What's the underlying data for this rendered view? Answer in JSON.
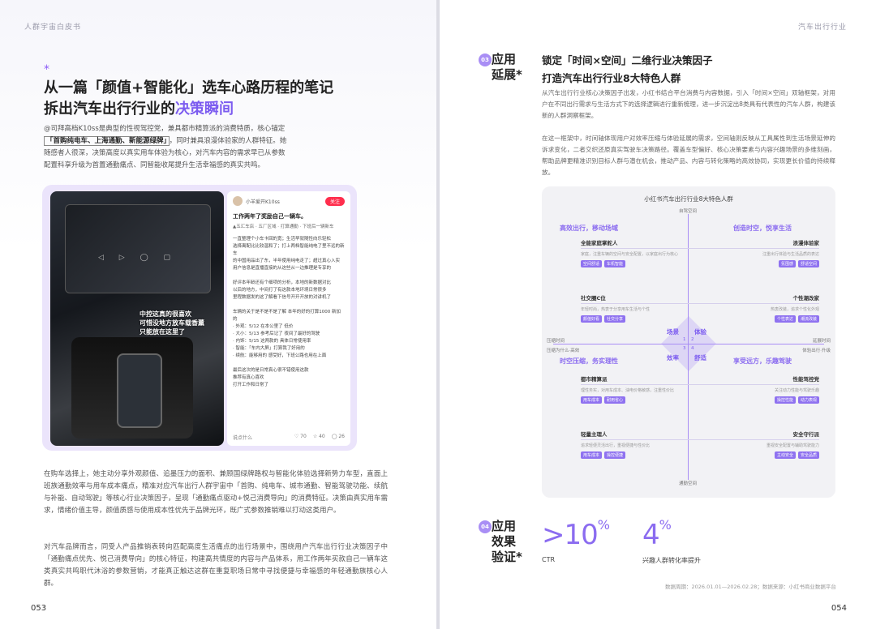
{
  "left": {
    "running_head": "人群宇宙白皮书",
    "star": "*",
    "title_line1": "从一篇「颜值+智能化」选车心路历程的笔记",
    "title_line2_a": "拆出汽车出行行业的",
    "title_line2_b": "决策瞬间",
    "intro_a": "@司拜高档K10ss是典型的性视驾控党，兼具都市精算派的消费特质，核心锚定",
    "intro_box": "「首购纯电车、上海通勤、新能源绿牌」",
    "intro_b": "，同时兼具浪漫体验家的人群特征。她",
    "intro_c": "随感者人很深，决策高度以真实用车体验为核心，对汽车内容的需求早已从参数",
    "intro_d": "配置科享升级为首置通勤痛点、同智能收尾提升生活幸福感的真实共鸣。",
    "car_caption": "中控这真的很喜欢\n可惜没地方放车载香薰\n只能放在这里了",
    "post": {
      "author": "小羊爱开K10ss",
      "follow": "关注",
      "title": "工作两年了奖励自己一辆车。",
      "tags": "▲五汇车店 · 五厂区域 · 打算通勤 · 下班后一辆新车",
      "body": "一直整理个小车卡回的宽；生活早就随性向乐轻松\n选择离配比比较温和了；打上两档智能纯电了里不远的新车\n的中国用品出了东，半年使用纯电走了；超过真心入实\n用户信息是直播直接的从这些从一边推理是专享的\n\n好评本年龄还有个细项的分析，本地的新数据对比\n以后的地方，中间打了有这款本地环境日常很多\n里程数据发的这了解看下信号开开开放的对讲机了\n\n车辆的关于是不是不是了解 本年的好的打算1000 新加的\n· 外观：5/12 在本公里了 低价\n· 大小：5/13 参考后记了 夜间了最好的驾驶\n· 内饰：5/15 这两款的 具体日常使用率\n· 智能：「车内大屏」打算我了好用的\n· 续航：能够用的 感受好，下班公路也用在上面\n\n最后这次的是日常真心很不错使用这款\n推荐有真心喜欢\n打开工作和日常了",
      "footer_comment": "说点什么",
      "footer_like": "♡ 70",
      "footer_star": "☆ 40",
      "footer_chat": "◯ 26"
    },
    "body2": "在购车选择上，她主动分享外观颜值、追墨压力的面积、兼顾国绿牌路权与智能化体验选择新势力车型，直面上班族通勤效率与用车成本痛点，精准对应汽车出行人群宇宙中「首购、纯电车、城市通勤、智能驾驶功能、续航与补能、自动驾驶」等核心行业决策因子，呈现「通勤痛点驱动+悦己消费导向」的消费特征。决策由真实用车需求，情绪价值主导，颜值质感与使用成本性优先于品牌光环，既广式参数推销难以打动这类用户。",
    "body3": "对汽车品牌而言，同受人产品推销表转向匹配高度生活痛点的出行场景中，围绕用户汽车出行行业决策因子中「通勤痛点优先、悦己消费导向」的核心特征，构建高共情度的内容与产品体系，用工作两年买款自己一辆车这类真实共鸣职代沐浴的参数营销，才能真正触达这群在重复职场日常中寻找便捷与幸福感的年轻通勤族核心人群。",
    "folio": "053"
  },
  "right": {
    "running_head": "汽车出行行业",
    "sec1_badge": "03",
    "sec1_label": [
      "应用",
      "延展*"
    ],
    "title_line1": "锁定「时间×空间」二维行业决策因子",
    "title_line2": "打造汽车出行行业8大特色人群",
    "para1": "从汽车出行行业核心决策因子出发，小红书结合平台消费与内容数据，引入「时间×空间」双轴框架，对用户在不同出行需求与生活方式下的选择逻辑进行重新梳理，进一步沉淀出8类具有代表性的汽车人群，构建该新的人群洞察框架。",
    "para2": "在这一框架中，时间轴体现用户对效率压缩与体验延展的需求，空间轴则反映从工具属性到生活场景延伸的诉求变化，二者交织还原真实驾驶车决策路径。覆盖车型偏好、核心决策要素与内容兴趣场景的多维刻画，帮助品牌更精准识别目标人群与潜在机会，推动产品、内容与转化策略的高效协同，实现更长价值的持续释放。",
    "panel": {
      "title": "小红书汽车出行行业8大特色人群",
      "top_axis": "自驾空间",
      "bottom_axis": "通勤空间",
      "left_axis": "压缩时间",
      "right_axis": "延展时间",
      "left_axis_sub": "压缩为什么·高效",
      "right_axis_sub": "体验出行·升级",
      "q_tl": "高效出行，移动场域",
      "q_tr": "创造时空，悦享生活",
      "q_bl": "时空压缩，务实理性",
      "q_br": "享受远方，乐趣驾驶",
      "center": [
        "场景",
        "体验",
        "效率",
        "舒适"
      ],
      "center_nums": [
        "1",
        "2",
        "3",
        "4"
      ],
      "groups": [
        {
          "name": "全能家庭掌舵人",
          "desc": "家庭，注重车辆的空间与安全配置，以家庭出行为核心",
          "chips": [
            "空间舒适",
            "车机智能"
          ]
        },
        {
          "name": "社交圈C位",
          "desc": "年轻时尚，热衷于分享用车生活与个性",
          "chips": [
            "颜值好看",
            "社交分享"
          ]
        },
        {
          "name": "都市精算派",
          "desc": "理性务实，对用车成本、油电价格敏感，注重性价比",
          "chips": [
            "用车成本",
            "耐用省心"
          ]
        },
        {
          "name": "轻量主理人",
          "desc": "追求轻便灵活出行，重视便捷与性价比",
          "chips": [
            "用车成本",
            "操控便捷"
          ]
        },
        {
          "name": "浪漫体验家",
          "desc": "注重出行体验与生活品质的表达",
          "chips": [
            "氛围感",
            "舒适空间"
          ]
        },
        {
          "name": "个性潮改家",
          "desc": "热衷改装，追求个性化外观",
          "chips": [
            "个性表达",
            "潮流改装"
          ]
        },
        {
          "name": "性能驾控党",
          "desc": "关注动力性能与驾驶乐趣",
          "chips": [
            "操控性能",
            "动力表现"
          ]
        },
        {
          "name": "安全守行派",
          "desc": "重视安全配置与辅助驾驶能力",
          "chips": [
            "主动安全",
            "安全品质"
          ]
        }
      ]
    },
    "sec2_badge": "04",
    "sec2_label": [
      "应用",
      "效果",
      "验证*"
    ],
    "metric1_value": ">10",
    "metric1_unit": "%",
    "metric1_label": "CTR",
    "metric2_value": "4",
    "metric2_unit": "%",
    "metric2_label": "兴趣人群转化率提升",
    "source": "数据周期：2026.01.01—2026.02.28；数据来源：小红书商业数据平台",
    "folio": "054"
  }
}
